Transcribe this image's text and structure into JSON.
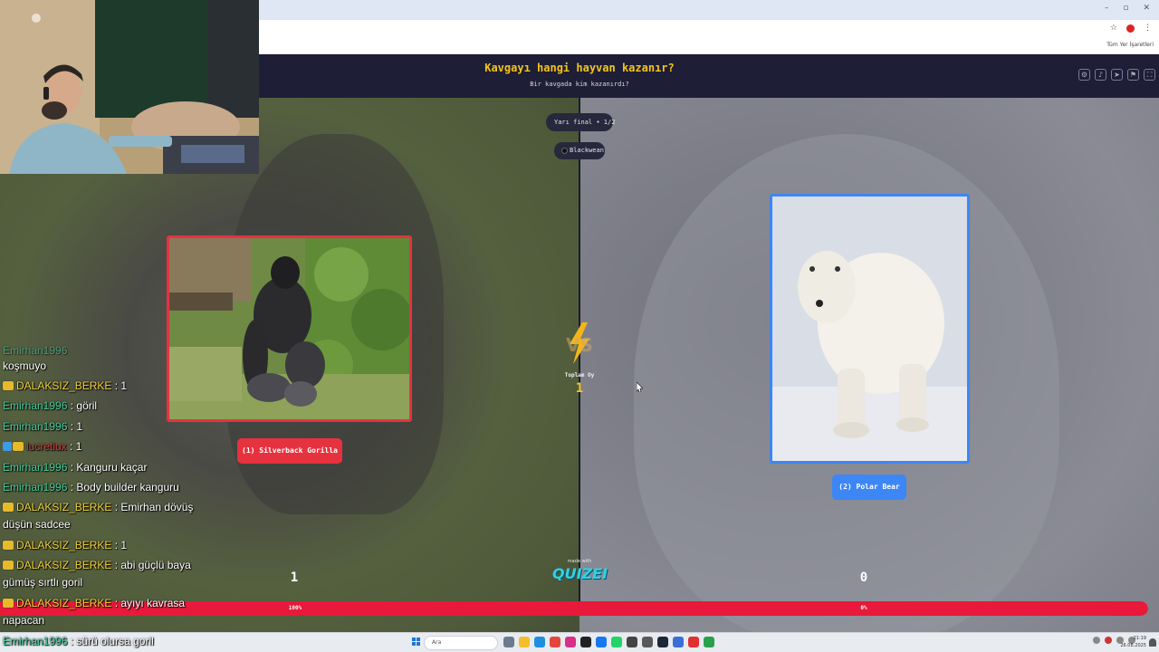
{
  "browser": {
    "window_controls": [
      "–",
      "▫",
      "✕"
    ],
    "bookmarks_label": "Tüm Yer İşaretleri"
  },
  "quiz": {
    "title": "Kavgayı hangi hayvan kazanır?",
    "subtitle": "Bir kavgada kim kazanırdı?",
    "round_badge": "Yarı final • 1/2",
    "creator": "Blackwean",
    "vs_text": "VS",
    "total_votes_label": "Toplam Oy",
    "total_votes": "1",
    "left_option": {
      "label": "(1) Silverback Gorilla",
      "votes": "1",
      "percent_label": "100%",
      "percent": 100
    },
    "right_option": {
      "label": "(2) Polar Bear",
      "votes": "0",
      "percent_label": "0%",
      "percent": 0
    },
    "made_with": "made with",
    "logo_text": "QUIZEI",
    "colors": {
      "left": "#e6323f",
      "right": "#3d86f5",
      "accent": "#f5c518",
      "header_bg": "#1e1e36"
    }
  },
  "chat": {
    "messages": [
      {
        "user": "Emirhan1996",
        "text": "koşmuyo",
        "partial": true,
        "color": "green",
        "badges": []
      },
      {
        "user": "DALAKSIZ_BERKE",
        "text": ": 1",
        "color": "yellow",
        "badges": [
          "crown"
        ]
      },
      {
        "user": "Emirhan1996",
        "text": ": göril",
        "color": "green",
        "badges": []
      },
      {
        "user": "Emirhan1996",
        "text": ": 1",
        "color": "green",
        "badges": []
      },
      {
        "user": "lucretiux",
        "text": ": 1",
        "color": "red",
        "badges": [
          "star",
          "crown"
        ]
      },
      {
        "user": "Emirhan1996",
        "text": ": Kanguru kaçar",
        "color": "green",
        "badges": []
      },
      {
        "user": "Emirhan1996",
        "text": ": Body builder kanguru",
        "color": "green",
        "badges": []
      },
      {
        "user": "DALAKSIZ_BERKE",
        "text": ": Emirhan dövüş düşün sadcee",
        "color": "yellow",
        "badges": [
          "crown"
        ]
      },
      {
        "user": "DALAKSIZ_BERKE",
        "text": ": 1",
        "color": "yellow",
        "badges": [
          "crown"
        ]
      },
      {
        "user": "DALAKSIZ_BERKE",
        "text": ": abi güçlü baya gümüş sırtlı goril",
        "color": "yellow",
        "badges": [
          "crown"
        ]
      },
      {
        "user": "DALAKSIZ_BERKE",
        "text": ": ayıyı kavrasa napacan",
        "color": "yellow",
        "badges": [
          "crown"
        ]
      },
      {
        "user": "Emirhan1996",
        "text": ": sürü olursa goril",
        "color": "green",
        "badges": []
      }
    ]
  },
  "taskbar": {
    "search_placeholder": "Ara",
    "time": "21:19",
    "date": "26.08.2025"
  }
}
